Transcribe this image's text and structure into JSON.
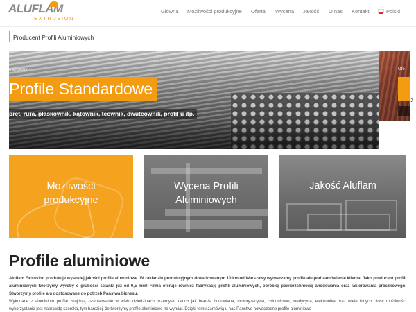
{
  "header": {
    "logo_main": "ALUFLAM",
    "logo_sub": "EXTRUSION",
    "nav": [
      "Główna",
      "Możliwości produkcyjne",
      "Oferta",
      "Wycena",
      "Jakość",
      "O nas",
      "Kontakt"
    ],
    "language": "Polski"
  },
  "breadcrumb": {
    "title": "Producent Profili Aluminiowych"
  },
  "hero": {
    "kicker": "oferujemy:",
    "title": "Profile Standardowe",
    "subtitle": "pręt, rura, płaskownik, kątownik, teownik, dwuteownik, profil u itp.",
    "peek_kicker": "Ofe"
  },
  "tiles": [
    {
      "label_line1": "Możliwości",
      "label_line2": "produkcyjne"
    },
    {
      "label_line1": "Wycena Profili",
      "label_line2": "Aluminiowych"
    },
    {
      "label_line1": "Jakość Aluflam",
      "label_line2": ""
    }
  ],
  "content": {
    "heading": "Profile aluminiowe",
    "p1": "Aluflam Extrusion produkuje wysokiej jakości profile aluminiowe. W zakładzie produkcyjnym zlokalizowanym 10 km od Warszawy wytwarzamy profile alu pod zamówienie klienta. Jako producent profili aluminiowych tworzymy wyroby o grubości ścianki już od 0,5 mm! Firma oferuje również fabrykację profili aluminiowych, obróbkę powierzchniową anodowania oraz lakierowania proszkowego. Stworzymy profile alu dostosowane do potrzeb Państwa biznesu.",
    "p2": "Wykonane z aluminium profile znajdują zastosowanie w wielu dziedzinach przemysłu takich jak branża budowlana, motoryzacyjna, chłodnictwo, medycyna, elektronika oraz wiele innych. Ilość możliwości wykorzystania jest naprawdę szeroka, tym bardziej, że tworzymy profile aluminiowe na wymiar. Dzięki temu zamówią u nas Państwo nowoczesne profile aluminiowe"
  },
  "colors": {
    "accent": "#f39c12",
    "text": "#333333"
  }
}
